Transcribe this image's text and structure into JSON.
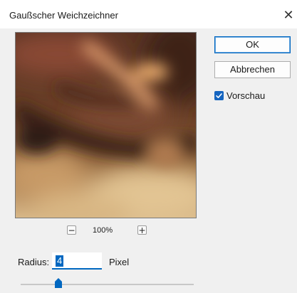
{
  "window": {
    "title": "Gaußscher Weichzeichner",
    "close_glyph": "✕"
  },
  "preview": {
    "zoom_out_glyph": "−",
    "zoom_in_glyph": "+",
    "zoom_level": "100%"
  },
  "buttons": {
    "ok_label": "OK",
    "cancel_label": "Abbrechen"
  },
  "preview_toggle": {
    "label": "Vorschau",
    "checked": true
  },
  "radius": {
    "label": "Radius:",
    "value": "4",
    "unit": "Pixel",
    "slider_fraction": 0.22
  },
  "colors": {
    "accent": "#0067c0",
    "checkbox": "#1565c0"
  }
}
